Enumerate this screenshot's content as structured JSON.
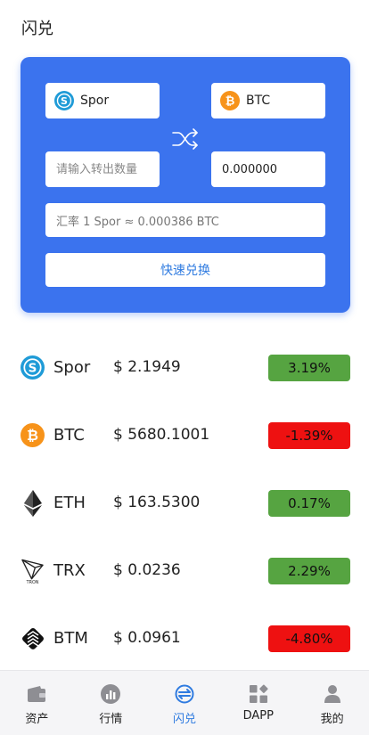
{
  "header": {
    "title": "闪兑"
  },
  "exchange": {
    "from_coin": "Spor",
    "to_coin": "BTC",
    "amount_placeholder": "请输入转出数量",
    "output_amount": "0.000000",
    "rate_text": "汇率 1 Spor ≈ 0.000386 BTC",
    "button_label": "快速兑换"
  },
  "market": [
    {
      "symbol": "Spor",
      "price": "$ 2.1949",
      "change": "3.19%",
      "direction": "up",
      "icon": "spor-coin-icon"
    },
    {
      "symbol": "BTC",
      "price": "$ 5680.1001",
      "change": "-1.39%",
      "direction": "down",
      "icon": "btc-coin-icon"
    },
    {
      "symbol": "ETH",
      "price": "$ 163.5300",
      "change": "0.17%",
      "direction": "up",
      "icon": "eth-coin-icon"
    },
    {
      "symbol": "TRX",
      "price": "$ 0.0236",
      "change": "2.29%",
      "direction": "up",
      "icon": "tron-coin-icon"
    },
    {
      "symbol": "BTM",
      "price": "$ 0.0961",
      "change": "-4.80%",
      "direction": "down",
      "icon": "btm-coin-icon"
    }
  ],
  "tabbar": {
    "items": [
      {
        "label": "资产",
        "icon": "wallet-icon"
      },
      {
        "label": "行情",
        "icon": "chart-icon"
      },
      {
        "label": "闪兑",
        "icon": "exchange-icon",
        "active": true
      },
      {
        "label": "DAPP",
        "icon": "dapp-grid-icon"
      },
      {
        "label": "我的",
        "icon": "user-icon"
      }
    ]
  },
  "colors": {
    "accent": "#3b73ee",
    "active_tab": "#2f7be0",
    "up": "#56a441",
    "down": "#ee1111",
    "btc": "#f7931a",
    "spor": "#1f9bd7"
  }
}
